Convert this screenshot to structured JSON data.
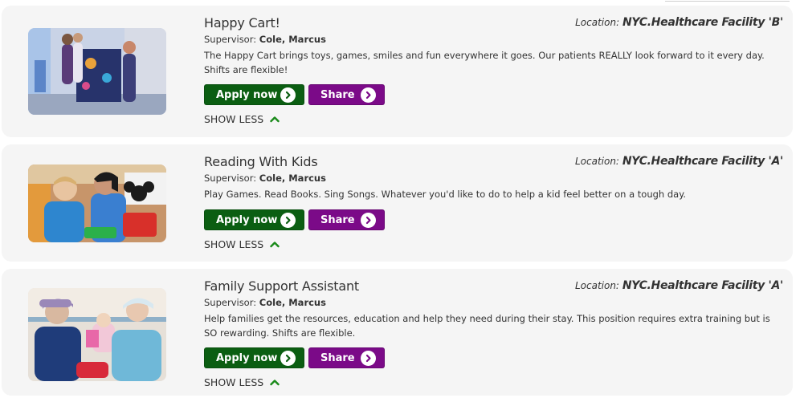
{
  "colors": {
    "apply": "#0b5e12",
    "share": "#7b0a88",
    "card_bg": "#f5f5f5"
  },
  "listings": [
    {
      "title": "Happy Cart!",
      "location_label": "Location:",
      "location": "NYC.Healthcare Facility 'B'",
      "supervisor_label": "Supervisor:",
      "supervisor": "Cole, Marcus",
      "description": "The Happy Cart brings toys, games, smiles and fun everywhere it goes. Our patients REALLY look forward to it every day. Shifts are flexible!",
      "apply_label": "Apply now",
      "share_label": "Share",
      "show_less_label": "SHOW LESS"
    },
    {
      "title": "Reading With Kids",
      "location_label": "Location:",
      "location": "NYC.Healthcare Facility 'A'",
      "supervisor_label": "Supervisor:",
      "supervisor": "Cole, Marcus",
      "description": "Play Games. Read Books. Sing Songs. Whatever you'd like to do to help a kid feel better on a tough day.",
      "apply_label": "Apply now",
      "share_label": "Share",
      "show_less_label": "SHOW LESS"
    },
    {
      "title": "Family Support Assistant",
      "location_label": "Location:",
      "location": "NYC.Healthcare Facility 'A'",
      "supervisor_label": "Supervisor:",
      "supervisor": "Cole, Marcus",
      "description": "Help families get the resources, education and help they need during their stay. This position requires extra training but is SO rewarding. Shifts are flexible.",
      "apply_label": "Apply now",
      "share_label": "Share",
      "show_less_label": "SHOW LESS"
    }
  ]
}
